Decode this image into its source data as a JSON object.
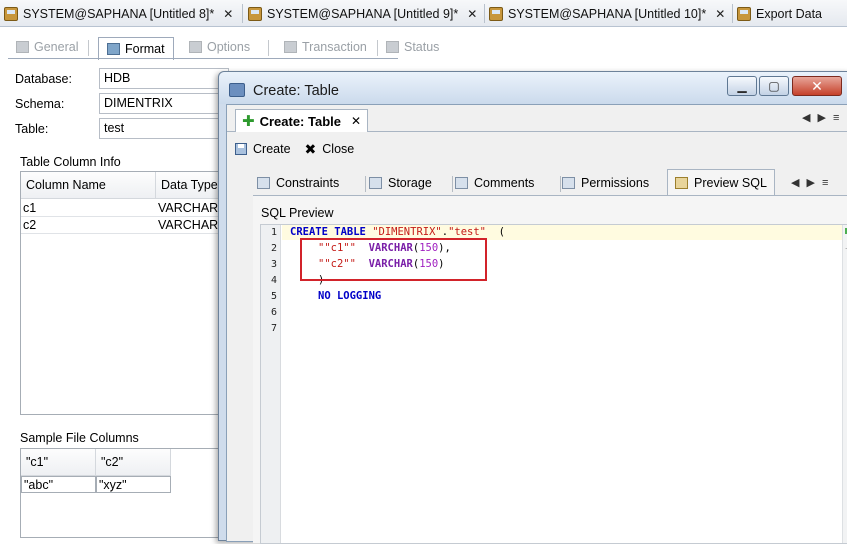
{
  "editor_tabs": [
    {
      "label": "SYSTEM@SAPHANA [Untitled 8]*"
    },
    {
      "label": "SYSTEM@SAPHANA [Untitled 9]*"
    },
    {
      "label": "SYSTEM@SAPHANA [Untitled 10]*"
    },
    {
      "label": "Export Data"
    }
  ],
  "back_panel": {
    "subtabs": [
      "General",
      "Format",
      "Options",
      "Transaction",
      "Status"
    ],
    "active_subtab": "Format",
    "fields": {
      "database_label": "Database:",
      "database_value": "HDB",
      "schema_label": "Schema:",
      "schema_value": "DIMENTRIX",
      "table_label": "Table:",
      "table_value": "test"
    },
    "column_info": {
      "title": "Table Column Info",
      "headers": [
        "Column Name",
        "Data Type"
      ],
      "rows": [
        [
          "c1",
          "VARCHAR"
        ],
        [
          "c2",
          "VARCHAR"
        ]
      ]
    },
    "sample_file": {
      "title": "Sample File Columns",
      "headers": [
        "\"c1\"",
        "\"c2\""
      ],
      "rows": [
        [
          "\"abc\"",
          "\"xyz\""
        ]
      ]
    }
  },
  "dialog": {
    "title": "Create: Table",
    "inner_tab": "Create: Table",
    "toolbar": {
      "create_label": "Create",
      "close_label": "Close"
    },
    "tabs": [
      "Constraints",
      "Storage",
      "Comments",
      "Permissions",
      "Preview SQL"
    ],
    "active_tab": "Preview SQL",
    "sql_preview": {
      "label": "SQL Preview",
      "line_numbers": [
        "1",
        "2",
        "3",
        "4",
        "5",
        "6",
        "7"
      ],
      "kw_create": "CREATE",
      "kw_table": "TABLE",
      "schema_str": "\"DIMENTRIX\"",
      "dot": ".",
      "table_str": "\"test\"",
      "open_paren": "(",
      "col1_name": "\"\"c1\"\"",
      "col2_name": "\"\"c2\"\"",
      "type_name": "VARCHAR",
      "type_len": "150",
      "close_paren": ")",
      "no_logging": "NO LOGGING"
    }
  }
}
